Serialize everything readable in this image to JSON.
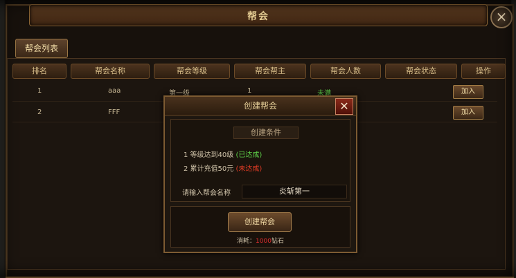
{
  "window": {
    "title": "帮会"
  },
  "tabs": [
    {
      "label": "帮会列表"
    }
  ],
  "table": {
    "columns": [
      "排名",
      "帮会名称",
      "帮会等级",
      "帮会帮主",
      "帮会人数",
      "帮会状态",
      "操作"
    ],
    "rows": [
      {
        "rank": "1",
        "name": "aaa",
        "level": "第一级",
        "leader": "1",
        "members": "",
        "status": "未满",
        "action": "加入"
      },
      {
        "rank": "2",
        "name": "FFF",
        "level": "",
        "leader": "",
        "members": "",
        "status": "",
        "action": "加入"
      }
    ]
  },
  "modal": {
    "title": "创建帮会",
    "conditions_title": "创建条件",
    "conditions": [
      {
        "text": "1 等级达到40级",
        "state": "(已达成)"
      },
      {
        "text": "2 累计充值50元",
        "state": "(未达成)"
      }
    ],
    "name_label": "请输入帮会名称",
    "name_value": "炎斩第一",
    "create_button": "创建帮会",
    "cost_label": "消耗：",
    "cost_value": "1000",
    "cost_unit": "钻石"
  },
  "colors": {
    "success": "#5fd24a",
    "fail": "#e03b24",
    "accent": "#a8804d"
  }
}
